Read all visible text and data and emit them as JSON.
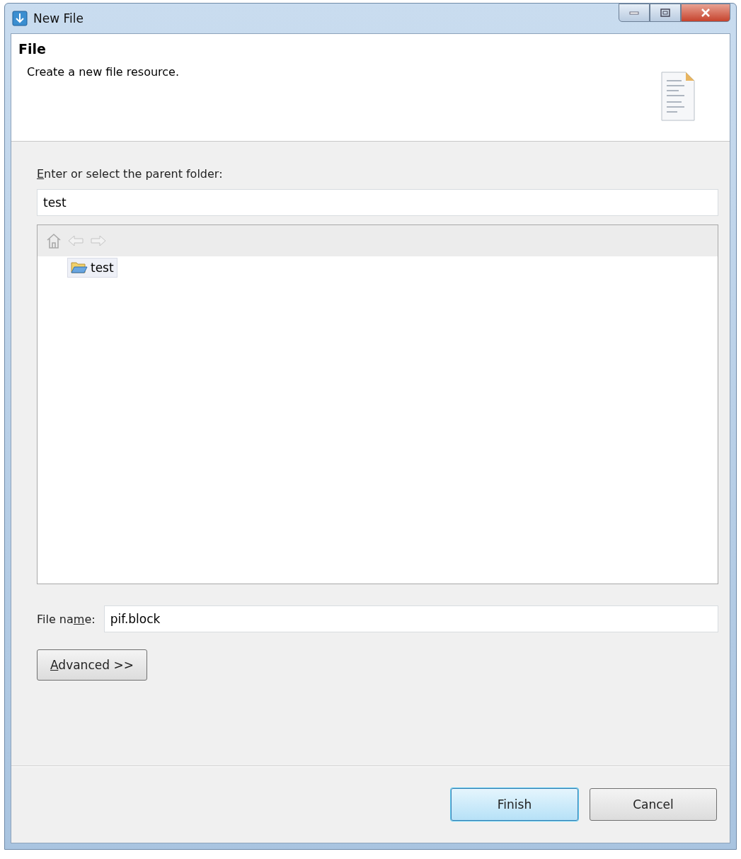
{
  "window": {
    "title": "New File"
  },
  "header": {
    "title": "File",
    "description": "Create a new file resource."
  },
  "parent_folder": {
    "label": {
      "key": "E",
      "post": "nter or select the parent folder:"
    },
    "value": "test"
  },
  "tree": {
    "items": [
      {
        "label": "test",
        "selected": true
      }
    ]
  },
  "file_name": {
    "label": {
      "pre": "File na",
      "key": "m",
      "post": "e:"
    },
    "value": "pif.block"
  },
  "advanced_button": {
    "key": "A",
    "post": "dvanced >>"
  },
  "buttons": [
    {
      "label": "Finish",
      "default": true
    },
    {
      "label": "Cancel",
      "default": false
    }
  ]
}
